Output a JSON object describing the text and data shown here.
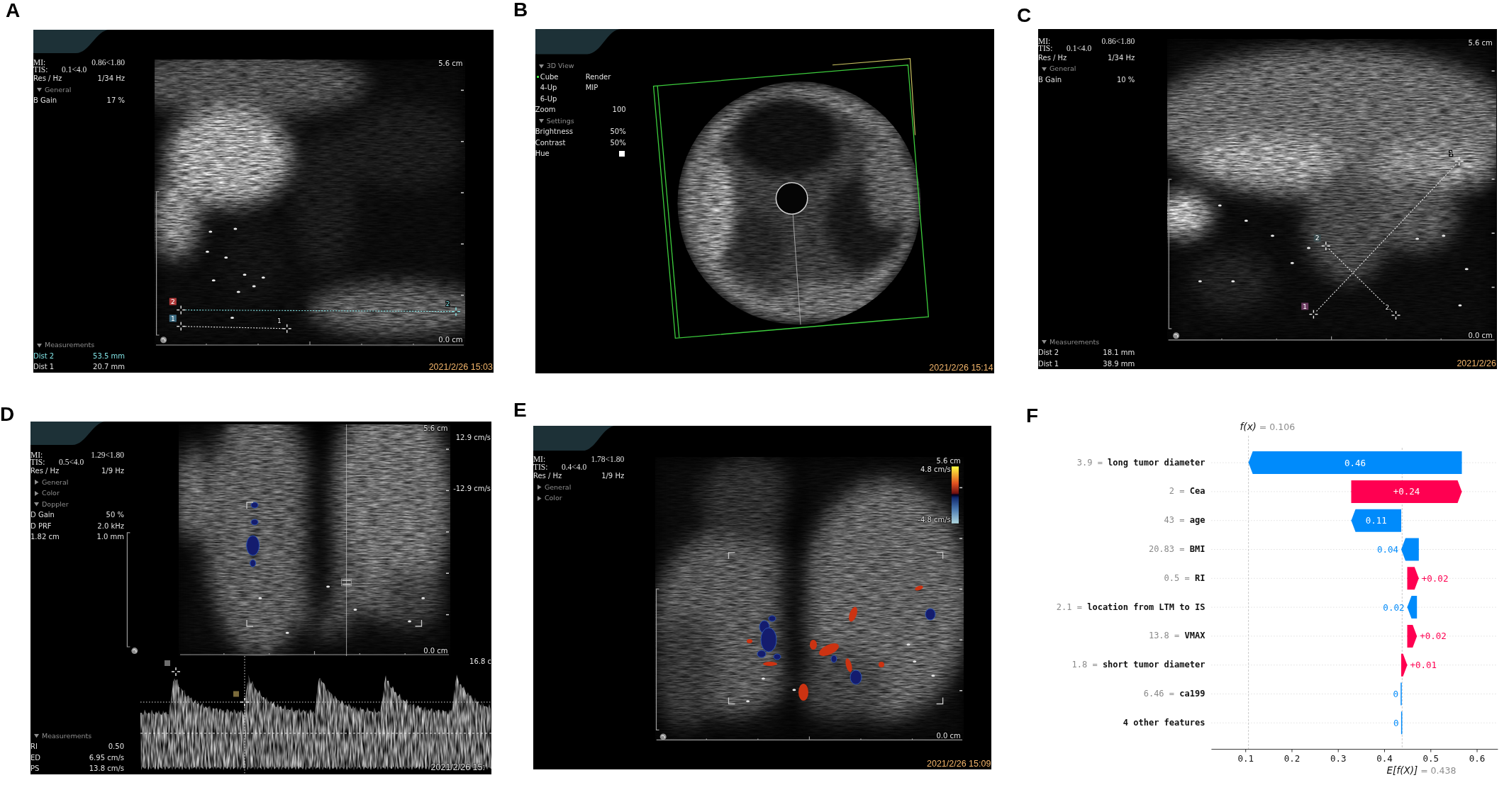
{
  "panels": [
    {
      "label": "A",
      "kind": "bmode",
      "readouts": [
        {
          "name": "MI:",
          "value": "0.86<1.80"
        },
        {
          "name": "TIS:",
          "value": "0.1<4.0"
        },
        {
          "name": "Res / Hz",
          "value": "1/34 Hz"
        }
      ],
      "menu": [
        {
          "kind": "section",
          "text": "General",
          "expanded": true
        },
        {
          "kind": "param",
          "name": "B Gain",
          "value": "17 %"
        }
      ],
      "depth_top": "5.6 cm",
      "depth_bottom": "0.0 cm",
      "calipers": [
        {
          "tag": "2",
          "color": "#b23a3a",
          "label": "2"
        },
        {
          "tag": "1",
          "color": "#3f6f86",
          "label": "1"
        }
      ],
      "measurements": {
        "title": "Measurements",
        "expanded": true,
        "rows": [
          {
            "name": "Dist 2",
            "value": "53.5 mm",
            "selected": true
          },
          {
            "name": "Dist 1",
            "value": "20.7 mm",
            "selected": false
          }
        ]
      },
      "timestamp": "2021/2/26 15:03"
    },
    {
      "label": "B",
      "kind": "render3d",
      "menu": [
        {
          "kind": "section",
          "text": "3D View",
          "expanded": true
        },
        {
          "kind": "option",
          "name": "Cube",
          "value": "Render",
          "selected": true
        },
        {
          "kind": "option",
          "name": "4-Up",
          "value": "MIP",
          "selected": false
        },
        {
          "kind": "option",
          "name": "6-Up",
          "selected": false
        },
        {
          "kind": "param",
          "name": "Zoom",
          "value": "100"
        },
        {
          "kind": "section",
          "text": "Settings",
          "expanded": true
        },
        {
          "kind": "param",
          "name": "Brightness",
          "value": "50%"
        },
        {
          "kind": "param",
          "name": "Contrast",
          "value": "50%"
        },
        {
          "kind": "swatch",
          "name": "Hue",
          "color": "#ffffff"
        }
      ],
      "timestamp": "2021/2/26 15:14"
    },
    {
      "label": "C",
      "kind": "bmode",
      "readouts": [
        {
          "name": "MI:",
          "value": "0.86<1.80"
        },
        {
          "name": "TIS:",
          "value": "0.1<4.0"
        },
        {
          "name": "Res / Hz",
          "value": "1/34 Hz"
        }
      ],
      "menu": [
        {
          "kind": "section",
          "text": "General",
          "expanded": true
        },
        {
          "kind": "param",
          "name": "B Gain",
          "value": "10 %"
        }
      ],
      "depth_top": "5.6 cm",
      "depth_bottom": "0.0 cm",
      "calipers": [
        {
          "tag": "2",
          "color": "#3b4b4e",
          "label": "2"
        },
        {
          "tag": "1",
          "color": "#6a3b60",
          "label": "1"
        }
      ],
      "measurements": {
        "title": "Measurements",
        "expanded": true,
        "rows": [
          {
            "name": "Dist 2",
            "value": "18.1 mm",
            "selected": false
          },
          {
            "name": "Dist 1",
            "value": "38.9 mm",
            "selected": false
          }
        ]
      },
      "timestamp": "2021/2/26"
    },
    {
      "label": "D",
      "kind": "doppler",
      "readouts": [
        {
          "name": "MI:",
          "value": "1.29<1.80"
        },
        {
          "name": "TIS:",
          "value": "0.5<4.0"
        },
        {
          "name": "Res / Hz",
          "value": "1/9 Hz"
        }
      ],
      "menu": [
        {
          "kind": "section",
          "text": "General",
          "expanded": false
        },
        {
          "kind": "section",
          "text": "Color",
          "expanded": false
        },
        {
          "kind": "section",
          "text": "Doppler",
          "expanded": true
        },
        {
          "kind": "param",
          "name": "D Gain",
          "value": "50 %"
        },
        {
          "kind": "param",
          "name": "D PRF",
          "value": "2.0 kHz"
        },
        {
          "kind": "param",
          "name": "1.82 cm",
          "value": "1.0 mm"
        }
      ],
      "depth_top": "5.6 cm",
      "depth_bottom": "0.0 cm",
      "velocity_top": "12.9 cm/s",
      "velocity_bottom": "-12.9 cm/s",
      "spectrum_depth": "16.8 c",
      "measurements": {
        "title": "Measurements",
        "expanded": true,
        "rows": [
          {
            "name": "RI",
            "value": "0.50",
            "selected": false
          },
          {
            "name": "ED",
            "value": "6.95 cm/s",
            "selected": false
          },
          {
            "name": "PS",
            "value": "13.8 cm/s",
            "selected": false
          }
        ]
      },
      "timestamp": "2021/2/26 15:"
    },
    {
      "label": "E",
      "kind": "color",
      "readouts": [
        {
          "name": "MI:",
          "value": "1.78<1.80"
        },
        {
          "name": "TIS:",
          "value": "0.4<4.0"
        },
        {
          "name": "Res / Hz",
          "value": "1/9 Hz"
        }
      ],
      "menu": [
        {
          "kind": "section",
          "text": "General",
          "expanded": false
        },
        {
          "kind": "section",
          "text": "Color",
          "expanded": false
        }
      ],
      "depth_top": "5.6 cm",
      "depth_bottom": "0.0 cm",
      "velocity_top": "4.8 cm/s",
      "velocity_bottom": "-4.8 cm/s",
      "timestamp": "2021/2/26 15:09"
    },
    {
      "label": "F",
      "kind": "waterfall",
      "chart_data": {
        "type": "candlestick",
        "orientation": "horizontal",
        "grid": true,
        "categories": [
          "3.9 = **long tumor diameter**",
          "2 = **Cea**",
          "43 = **age**",
          "20.83 = **BMI**",
          "0.5 = **RI**",
          "2.1 = **location from LTM to IS**",
          "13.8 = **VMAX**",
          "1.8 = **short tumor diameter**",
          "6.46 = **ca199**",
          "**4 other features**"
        ],
        "series": [
          {
            "color": "#008bfb",
            "ohlc": [
              [
                0.567,
                0.567,
                0.106,
                0.106
              ],
              null,
              [
                0.436,
                0.436,
                0.328,
                0.328
              ],
              [
                0.474,
                0.474,
                0.436,
                0.436
              ],
              null,
              [
                0.47,
                0.47,
                0.449,
                0.449
              ],
              null,
              null,
              [
                0.437,
                0.437,
                0.436,
                0.436
              ],
              [
                0.438,
                0.438,
                0.437,
                0.437
              ]
            ]
          },
          {
            "color": "#ff0051",
            "ohlc": [
              null,
              [
                0.328,
                0.567,
                0.328,
                0.567
              ],
              null,
              null,
              [
                0.449,
                0.474,
                0.449,
                0.474
              ],
              null,
              [
                0.449,
                0.47,
                0.449,
                0.47
              ],
              [
                0.436,
                0.449,
                0.436,
                0.449
              ],
              null,
              null
            ]
          }
        ],
        "value_labels": [
          "0.46",
          "+0.24",
          "0.11",
          "0.04",
          "+0.02",
          "0.02",
          "+0.02",
          "+0.01",
          "0",
          "0"
        ],
        "xlim": [
          0.026,
          0.645
        ],
        "xticks": [
          0.1,
          0.2,
          0.3,
          0.4,
          0.5,
          0.6
        ],
        "ref_lines": [
          {
            "value": 0.106,
            "axis": "x"
          },
          {
            "value": 0.438,
            "axis": "x"
          }
        ],
        "annotations": [
          "*f(x)* = 0.106",
          "*E[f(X)]* = 0.438"
        ]
      }
    }
  ]
}
